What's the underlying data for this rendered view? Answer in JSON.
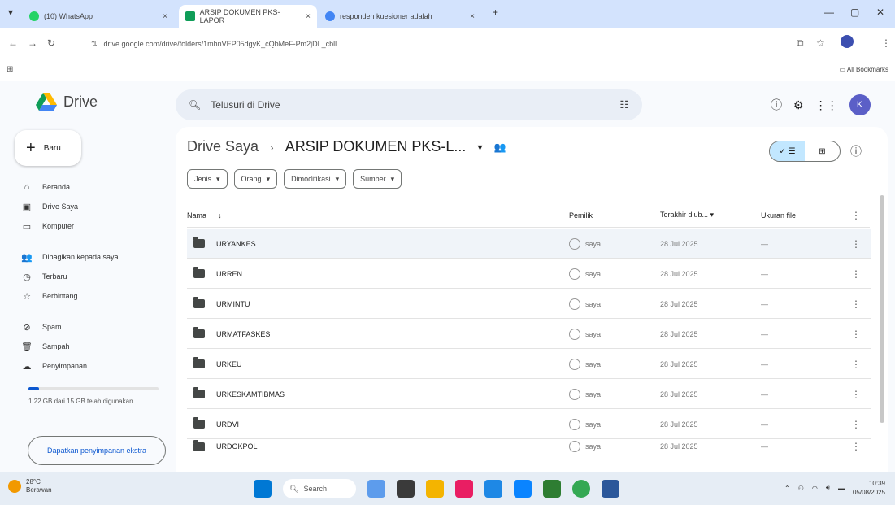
{
  "browser": {
    "tabs": [
      {
        "label": "(10) WhatsApp",
        "favicon_color": "#25d366"
      },
      {
        "label": "ARSIP DOKUMEN PKS-LAPOR",
        "favicon_color": "#0f9d58"
      },
      {
        "label": "responden kuesioner adalah",
        "favicon_color": "#4285f4"
      }
    ],
    "new_tab": "+",
    "url": "drive.google.com/drive/folders/1mhnVEP05dgyK_cQbMeF-Pm2jDL_cbll",
    "bookmarks_label": "All Bookmarks"
  },
  "drive": {
    "logo_text": "Drive",
    "search_placeholder": "Telusuri di Drive",
    "new_button": "Baru",
    "avatar_letter": "K",
    "nav": [
      {
        "label": "Beranda",
        "icon": "home-icon",
        "glyph": "⌂"
      },
      {
        "label": "Drive Saya",
        "icon": "my-drive-icon",
        "glyph": "▣"
      },
      {
        "label": "Komputer",
        "icon": "computer-icon",
        "glyph": "▭"
      },
      {
        "label": "Dibagikan kepada saya",
        "icon": "shared-icon",
        "glyph": "👥"
      },
      {
        "label": "Terbaru",
        "icon": "clock-icon",
        "glyph": "◷"
      },
      {
        "label": "Berbintang",
        "icon": "star-icon",
        "glyph": "☆"
      },
      {
        "label": "Spam",
        "icon": "spam-icon",
        "glyph": "⊘"
      },
      {
        "label": "Sampah",
        "icon": "trash-icon",
        "glyph": "🗑"
      },
      {
        "label": "Penyimpanan",
        "icon": "cloud-icon",
        "glyph": "☁"
      }
    ],
    "storage": {
      "text": "1,22 GB dari 15 GB telah digunakan",
      "used_fraction": 0.08,
      "button": "Dapatkan penyimpanan ekstra"
    },
    "breadcrumb": {
      "root": "Drive Saya",
      "separator": "›",
      "current": "ARSIP DOKUMEN PKS-L...",
      "dropdown": "▾"
    },
    "filters": [
      "Jenis",
      "Orang",
      "Dimodifikasi",
      "Sumber"
    ],
    "columns": {
      "name": "Nama",
      "sort_arrow": "↓",
      "owner": "Pemilik",
      "modified": "Terakhir diub...",
      "size": "Ukuran file"
    },
    "rows": [
      {
        "name": "URYANKES",
        "owner": "saya",
        "modified": "28 Jul 2025",
        "size": "—"
      },
      {
        "name": "URREN",
        "owner": "saya",
        "modified": "28 Jul 2025",
        "size": "—"
      },
      {
        "name": "URMINTU",
        "owner": "saya",
        "modified": "28 Jul 2025",
        "size": "—"
      },
      {
        "name": "URMATFASKES",
        "owner": "saya",
        "modified": "28 Jul 2025",
        "size": "—"
      },
      {
        "name": "URKEU",
        "owner": "saya",
        "modified": "28 Jul 2025",
        "size": "—"
      },
      {
        "name": "URKESKAMTIBMAS",
        "owner": "saya",
        "modified": "28 Jul 2025",
        "size": "—"
      },
      {
        "name": "URDVI",
        "owner": "saya",
        "modified": "28 Jul 2025",
        "size": "—"
      },
      {
        "name": "URDOKPOL",
        "owner": "saya",
        "modified": "28 Jul 2025",
        "size": "—"
      }
    ]
  },
  "taskbar": {
    "weather_temp": "28°C",
    "weather_desc": "Berawan",
    "search_label": "Search",
    "time": "10:39",
    "date": "05/08/2025"
  }
}
